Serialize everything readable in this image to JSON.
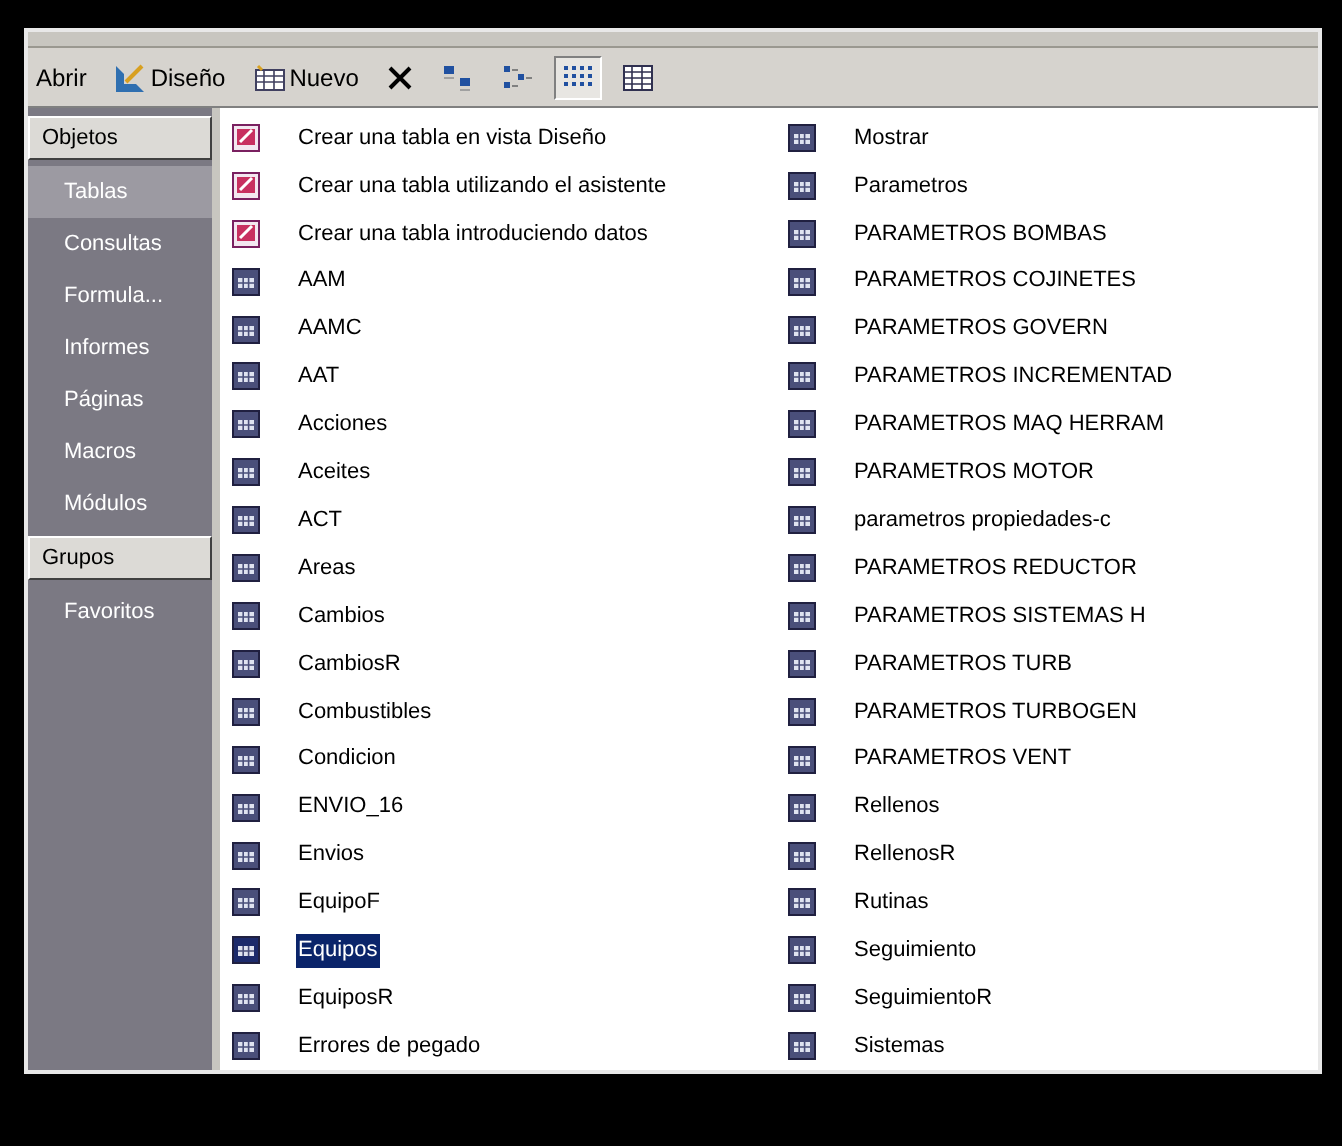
{
  "toolbar": {
    "buttons": [
      {
        "kind": "open",
        "label": "Abrir"
      },
      {
        "kind": "design",
        "label": "Diseño"
      },
      {
        "kind": "new",
        "label": "Nuevo"
      },
      {
        "kind": "delete"
      },
      {
        "kind": "large-icons"
      },
      {
        "kind": "small-icons"
      },
      {
        "kind": "list",
        "selected": true
      },
      {
        "kind": "details",
        "selected": false
      }
    ]
  },
  "sidebar": {
    "sections": [
      {
        "header": "Objetos",
        "items": [
          {
            "label": "Tablas",
            "selected": true
          },
          {
            "label": "Consultas",
            "selected": false
          },
          {
            "label": "Formula...",
            "selected": false
          },
          {
            "label": "Informes",
            "selected": false
          },
          {
            "label": "Páginas",
            "selected": false
          },
          {
            "label": "Macros",
            "selected": false
          },
          {
            "label": "Módulos",
            "selected": false
          }
        ]
      },
      {
        "header": "Grupos",
        "items": [
          {
            "label": "Favoritos",
            "selected": false
          }
        ]
      }
    ]
  },
  "columns": [
    [
      {
        "kind": "create",
        "label": "Crear una tabla en vista Diseño",
        "selected": false
      },
      {
        "kind": "create",
        "label": "Crear una tabla utilizando el asistente",
        "selected": false
      },
      {
        "kind": "create",
        "label": "Crear una tabla introduciendo datos",
        "selected": false
      },
      {
        "kind": "table",
        "label": "AAM",
        "selected": false
      },
      {
        "kind": "table",
        "label": "AAMC",
        "selected": false
      },
      {
        "kind": "table",
        "label": "AAT",
        "selected": false
      },
      {
        "kind": "table",
        "label": "Acciones",
        "selected": false
      },
      {
        "kind": "table",
        "label": "Aceites",
        "selected": false
      },
      {
        "kind": "table",
        "label": "ACT",
        "selected": false
      },
      {
        "kind": "table",
        "label": "Areas",
        "selected": false
      },
      {
        "kind": "table",
        "label": "Cambios",
        "selected": false
      },
      {
        "kind": "table",
        "label": "CambiosR",
        "selected": false
      },
      {
        "kind": "table",
        "label": "Combustibles",
        "selected": false
      },
      {
        "kind": "table",
        "label": "Condicion",
        "selected": false
      },
      {
        "kind": "table",
        "label": "ENVIO_16",
        "selected": false
      },
      {
        "kind": "table",
        "label": "Envios",
        "selected": false
      },
      {
        "kind": "table",
        "label": "EquipoF",
        "selected": false
      },
      {
        "kind": "table",
        "label": "Equipos",
        "selected": true
      },
      {
        "kind": "table",
        "label": "EquiposR",
        "selected": false
      },
      {
        "kind": "table",
        "label": "Errores de pegado",
        "selected": false
      }
    ],
    [
      {
        "kind": "table",
        "label": "Mostrar",
        "selected": false
      },
      {
        "kind": "table",
        "label": "Parametros",
        "selected": false
      },
      {
        "kind": "table",
        "label": "PARAMETROS BOMBAS",
        "selected": false
      },
      {
        "kind": "table",
        "label": "PARAMETROS COJINETES",
        "selected": false
      },
      {
        "kind": "table",
        "label": "PARAMETROS GOVERN",
        "selected": false
      },
      {
        "kind": "table",
        "label": "PARAMETROS INCREMENTAD",
        "selected": false
      },
      {
        "kind": "table",
        "label": "PARAMETROS MAQ HERRAM",
        "selected": false
      },
      {
        "kind": "table",
        "label": "PARAMETROS MOTOR",
        "selected": false
      },
      {
        "kind": "table",
        "label": "parametros propiedades-c",
        "selected": false
      },
      {
        "kind": "table",
        "label": "PARAMETROS REDUCTOR",
        "selected": false
      },
      {
        "kind": "table",
        "label": "PARAMETROS SISTEMAS H",
        "selected": false
      },
      {
        "kind": "table",
        "label": "PARAMETROS TURB",
        "selected": false
      },
      {
        "kind": "table",
        "label": "PARAMETROS TURBOGEN",
        "selected": false
      },
      {
        "kind": "table",
        "label": "PARAMETROS VENT",
        "selected": false
      },
      {
        "kind": "table",
        "label": "Rellenos",
        "selected": false
      },
      {
        "kind": "table",
        "label": "RellenosR",
        "selected": false
      },
      {
        "kind": "table",
        "label": "Rutinas",
        "selected": false
      },
      {
        "kind": "table",
        "label": "Seguimiento",
        "selected": false
      },
      {
        "kind": "table",
        "label": "SeguimientoR",
        "selected": false
      },
      {
        "kind": "table",
        "label": "Sistemas",
        "selected": false
      }
    ]
  ]
}
